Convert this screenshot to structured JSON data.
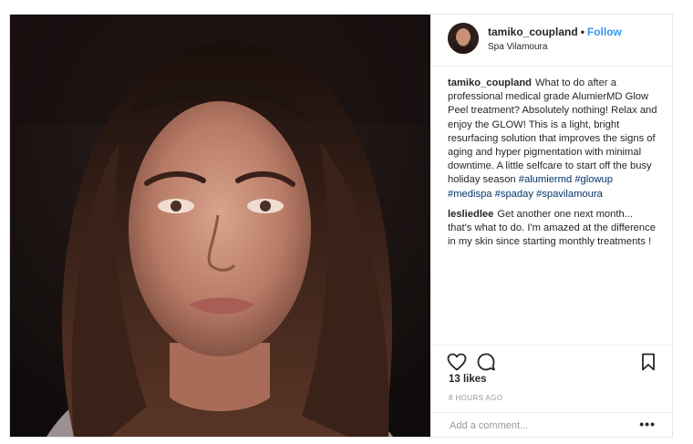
{
  "post": {
    "username": "tamiko_coupland",
    "follow_label": "Follow",
    "dot": "•",
    "location": "Spa Vilamoura",
    "caption": {
      "user": "tamiko_coupland",
      "text": "What to do after a professional medical grade AlumierMD Glow Peel treatment? Absolutely nothing! Relax and enjoy the GLOW! This is a light, bright resurfacing solution that improves the signs of aging and hyper pigmentation with minimal downtime. A little selfcare to start off the busy holiday season",
      "hashtags": [
        "#alumiermd",
        "#glowup",
        "#medispa",
        "#spaday",
        "#spavilamoura"
      ]
    },
    "comments": [
      {
        "user": "lesliedlee",
        "text": "Get another one next month... that's what to do. I'm amazed at the difference in my skin since starting monthly treatments !"
      }
    ],
    "likes": "13 likes",
    "timestamp": "8 HOURS AGO",
    "add_comment_placeholder": "Add a comment...",
    "more_label": "•••"
  },
  "icons": [
    "heart-icon",
    "comment-icon",
    "bookmark-icon",
    "more-options-icon"
  ]
}
